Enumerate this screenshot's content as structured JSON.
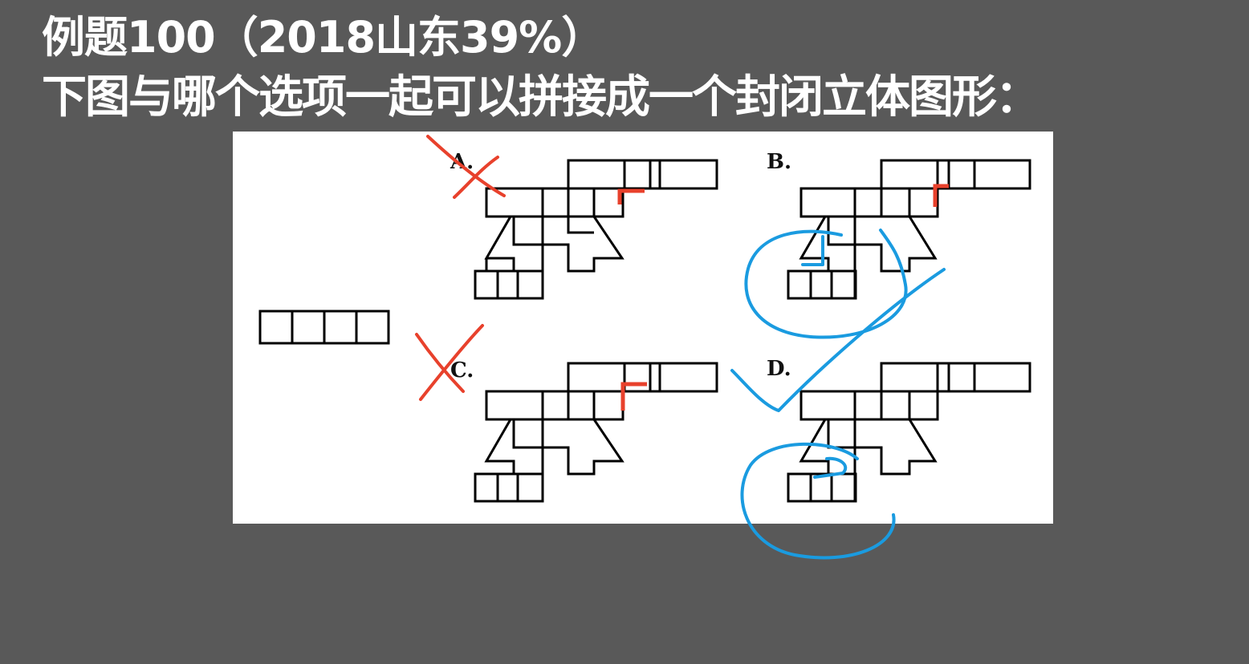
{
  "question": {
    "header": "例题100（2018山东39%）",
    "prompt": "下图与哪个选项一起可以拼接成一个封闭立体图形："
  },
  "figure": {
    "options": [
      "A.",
      "B.",
      "C.",
      "D."
    ],
    "given_piece_squares": 4,
    "wrong_marked_options": [
      "A.",
      "C."
    ],
    "checked_option": "D.",
    "colors": {
      "outline": "#000000",
      "marker_red": "#e8412c",
      "annotation_blue": "#1a9be0",
      "background": "#595959",
      "panel": "#ffffff",
      "text": "#ffffff"
    }
  }
}
